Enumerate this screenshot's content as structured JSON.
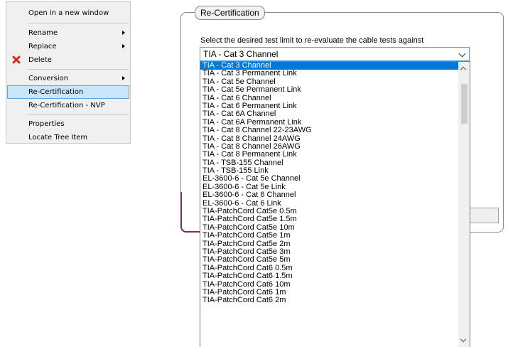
{
  "context_menu": {
    "items": [
      {
        "label": "Open in a new window",
        "submenu": false,
        "icon": ""
      },
      {
        "label": "Rename",
        "submenu": true,
        "icon": ""
      },
      {
        "label": "Replace",
        "submenu": true,
        "icon": ""
      },
      {
        "label": "Delete",
        "submenu": false,
        "icon": "red-x-icon"
      },
      {
        "label": "Conversion",
        "submenu": true,
        "icon": ""
      },
      {
        "label": "Re-Certification",
        "submenu": false,
        "icon": "",
        "selected": true
      },
      {
        "label": "Re-Certification - NVP",
        "submenu": false,
        "icon": ""
      },
      {
        "label": "Properties",
        "submenu": false,
        "icon": ""
      },
      {
        "label": "Locate Tree Item",
        "submenu": false,
        "icon": ""
      }
    ]
  },
  "recert": {
    "group_title": "Re-Certification",
    "prompt": "Select the desired test limit to re-evaluate the cable tests against",
    "selected": "TIA - Cat 3 Channel",
    "options": [
      "TIA - Cat 3 Channel",
      "TIA - Cat 3 Permanent Link",
      "TIA - Cat 5e Channel",
      "TIA - Cat 5e Permanent Link",
      "TIA - Cat 6 Channel",
      "TIA - Cat 6 Permanent Link",
      "TIA - Cat 6A Channel",
      "TIA - Cat 6A Permanent Link",
      "TIA - Cat 8 Channel 22-23AWG",
      "TIA - Cat 8 Channel 24AWG",
      "TIA - Cat 8 Channel 26AWG",
      "TIA - Cat 8 Permanent Link",
      "TIA - TSB-155 Channel",
      "TIA - TSB-155 Link",
      "EL-3600-6 - Cat 5e Channel",
      "EL-3600-6 - Cat 5e Link",
      "EL-3600-6 - Cat 6 Channel",
      "EL-3600-6 - Cat 6 Link",
      "TIA-PatchCord Cat5e 0.5m",
      "TIA-PatchCord Cat5e 1.5m",
      "TIA-PatchCord Cat5e 10m",
      "TIA-PatchCord Cat5e 1m",
      "TIA-PatchCord Cat5e 2m",
      "TIA-PatchCord Cat5e 3m",
      "TIA-PatchCord Cat5e 5m",
      "TIA-PatchCord Cat6 0.5m",
      "TIA-PatchCord Cat6 1.5m",
      "TIA-PatchCord Cat6 10m",
      "TIA-PatchCord Cat6 1m",
      "TIA-PatchCord Cat6 2m"
    ],
    "highlight_color": "#0078d7"
  }
}
